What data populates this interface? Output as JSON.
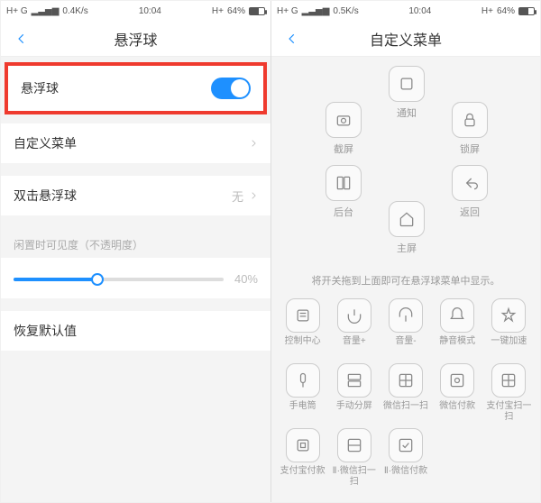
{
  "status": {
    "carrier": "H+ G",
    "signal": "▂▃▅▆",
    "net_speed_left": "0.4K/s",
    "net_speed_right": "0.5K/s",
    "time": "10:04",
    "h_plus": "H+",
    "battery_pct": "64%"
  },
  "left_page": {
    "title": "悬浮球",
    "main_toggle_label": "悬浮球",
    "custom_menu_label": "自定义菜单",
    "double_tap_label": "双击悬浮球",
    "double_tap_value": "无",
    "opacity_section": "闲置时可见度（不透明度）",
    "opacity_value": "40%",
    "restore_label": "恢复默认值"
  },
  "right_page": {
    "title": "自定义菜单",
    "radial": {
      "top": {
        "label": "通知"
      },
      "tl": {
        "label": "截屏"
      },
      "tr": {
        "label": "锁屏"
      },
      "bl": {
        "label": "后台"
      },
      "br": {
        "label": "返回"
      },
      "bottom": {
        "label": "主屏"
      }
    },
    "hint": "将开关拖到上面即可在悬浮球菜单中显示。",
    "grid": [
      {
        "label": "控制中心"
      },
      {
        "label": "音量+"
      },
      {
        "label": "音量-"
      },
      {
        "label": "静音模式"
      },
      {
        "label": "一键加速"
      },
      {
        "label": "手电筒"
      },
      {
        "label": "手动分屏"
      },
      {
        "label": "微信扫一扫"
      },
      {
        "label": "微信付款"
      },
      {
        "label": "支付宝扫一扫"
      },
      {
        "label": "支付宝付款"
      },
      {
        "label": "Ⅱ·微信扫一扫"
      },
      {
        "label": "Ⅱ·微信付款"
      }
    ]
  }
}
